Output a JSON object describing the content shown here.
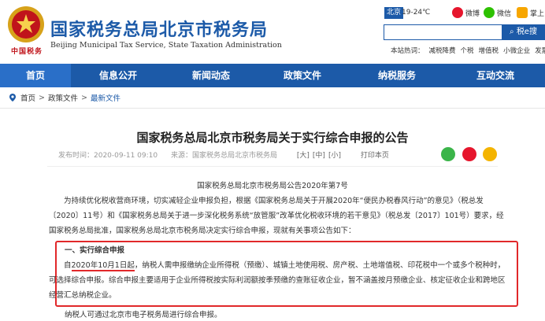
{
  "header": {
    "emblem_text": "中国税务",
    "title": "国家税务总局北京市税务局",
    "subtitle": "Beijing Municipal Tax Service, State Taxation Administration",
    "city": "北京",
    "weather": "19-24℃",
    "social": [
      {
        "label": "微博",
        "icon": "weibo-icon"
      },
      {
        "label": "微信",
        "icon": "wechat-icon"
      },
      {
        "label": "掌上",
        "icon": "mobile-icon"
      }
    ],
    "search": {
      "placeholder": "",
      "button": "税e搜"
    },
    "hotwords": [
      "本站热词：",
      "减税降费",
      "个税",
      "增值税",
      "小微企业",
      "发票"
    ]
  },
  "nav": [
    "首页",
    "信息公开",
    "新闻动态",
    "政策文件",
    "纳税服务",
    "互动交流"
  ],
  "breadcrumb": [
    "首页",
    "政策文件",
    "最新文件"
  ],
  "article": {
    "title": "国家税务总局北京市税务局关于实行综合申报的公告",
    "publish_time": "发布时间：2020-09-11 09:10",
    "source": "来源：国家税务总局北京市税务局",
    "size_label": [
      "[大]",
      "[中]",
      "[小]"
    ],
    "print": "打印本页",
    "doc_no": "国家税务总局北京市税务局公告2020年第7号",
    "para1": "为持续优化税收营商环境，切实减轻企业申报负担，根据《国家税务总局关于开展2020年“便民办税春风行动”的意见》（税总发〔2020〕11号）和《国家税务总局关于进一步深化税务系统“放管服”改革优化税收环境的若干意见》（税总发〔2017〕101号）要求，经国家税务总局批准，国家税务总局北京市税务局决定实行综合申报，现就有关事项公告如下：",
    "section1": "一、实行综合申报",
    "para2_prefix": "自",
    "para2_date": "2020年10月1日起",
    "para2_rest": "，纳税人需申报缴纳企业所得税（预缴）、城镇土地使用税、房产税、土地增值税、印花税中一个或多个税种时，可选择综合申报。综合申报主要适用于企业所得税按实际利润额按季预缴的查账征收企业，暂不涵盖按月预缴企业、核定征收企业和跨地区经营汇总纳税企业。",
    "para3": "纳税人可通过北京市电子税务局进行综合申报。"
  },
  "colors": {
    "brand": "#1c5aa8",
    "highlight": "#e1282a"
  }
}
